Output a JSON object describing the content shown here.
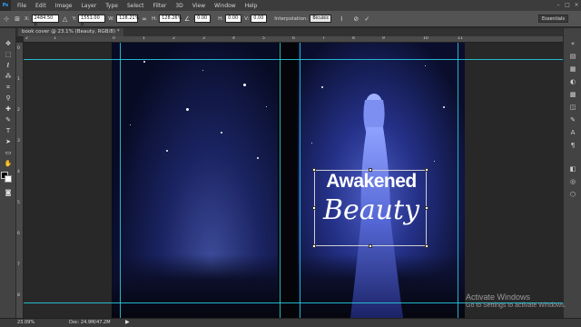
{
  "menu": {
    "logo": "Ps",
    "items": [
      "File",
      "Edit",
      "Image",
      "Layer",
      "Type",
      "Select",
      "Filter",
      "3D",
      "View",
      "Window",
      "Help"
    ]
  },
  "options": {
    "x_label": "X:",
    "x_value": "2484.50 p",
    "y_label": "Y:",
    "y_value": "1551.00 p",
    "w_label": "W:",
    "w_value": "128.21%",
    "h_label": "H:",
    "h_value": "128.26%",
    "angle_value": "0.00",
    "hskew_label": "H:",
    "hskew_value": "0.00",
    "vskew_label": "V:",
    "vskew_value": "0.00",
    "interp_label": "Interpolation:",
    "interp_value": "Bicubic",
    "workspace": "Essentials"
  },
  "document": {
    "tab_title": "book cover @ 23.1% (Beauty, RGB/8) *",
    "zoom": "23.09%",
    "doc_size": "Doc: 24.9M/47.2M"
  },
  "ruler_top_labels": [
    "2",
    "1",
    "0",
    "1",
    "2",
    "3",
    "4",
    "5",
    "6",
    "7",
    "8",
    "9",
    "10",
    "11"
  ],
  "ruler_left_labels": [
    "0",
    "1",
    "2",
    "3",
    "4",
    "5",
    "6",
    "7",
    "8"
  ],
  "cover": {
    "title_line1": "Awakened",
    "title_line2": "Beauty"
  },
  "watermark": {
    "line1": "Activate Windows",
    "line2": "Go to Settings to activate Windows."
  }
}
